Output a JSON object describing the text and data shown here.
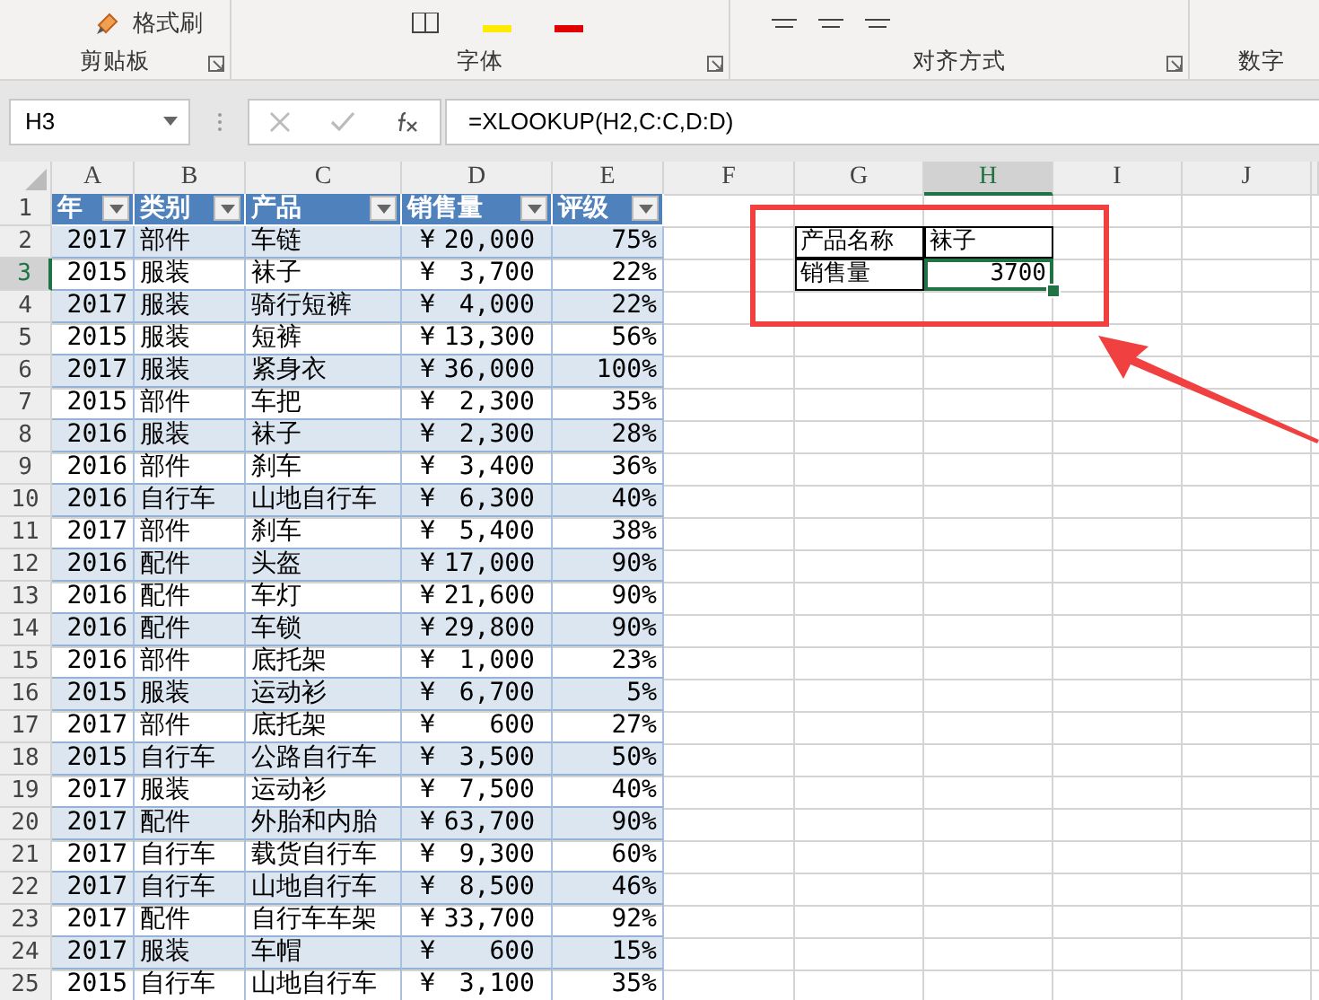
{
  "ribbon": {
    "format_painter": "格式刷",
    "groups": [
      {
        "label": "剪贴板"
      },
      {
        "label": "字体"
      },
      {
        "label": "对齐方式"
      },
      {
        "label": "数字"
      }
    ]
  },
  "formula_bar": {
    "name_box": "H3",
    "formula": "=XLOOKUP(H2,C:C,D:D)"
  },
  "column_headers": [
    {
      "label": "A",
      "selected": false
    },
    {
      "label": "B",
      "selected": false
    },
    {
      "label": "C",
      "selected": false
    },
    {
      "label": "D",
      "selected": false
    },
    {
      "label": "E",
      "selected": false
    },
    {
      "label": "F",
      "selected": false
    },
    {
      "label": "G",
      "selected": false
    },
    {
      "label": "H",
      "selected": true
    },
    {
      "label": "I",
      "selected": false
    },
    {
      "label": "J",
      "selected": false
    }
  ],
  "row_headers": [
    {
      "label": "1",
      "selected": false
    },
    {
      "label": "2",
      "selected": false
    },
    {
      "label": "3",
      "selected": true
    },
    {
      "label": "4",
      "selected": false
    },
    {
      "label": "5",
      "selected": false
    },
    {
      "label": "6",
      "selected": false
    },
    {
      "label": "7",
      "selected": false
    },
    {
      "label": "8",
      "selected": false
    },
    {
      "label": "9",
      "selected": false
    },
    {
      "label": "10",
      "selected": false
    },
    {
      "label": "11",
      "selected": false
    },
    {
      "label": "12",
      "selected": false
    },
    {
      "label": "13",
      "selected": false
    },
    {
      "label": "14",
      "selected": false
    },
    {
      "label": "15",
      "selected": false
    },
    {
      "label": "16",
      "selected": false
    },
    {
      "label": "17",
      "selected": false
    },
    {
      "label": "18",
      "selected": false
    },
    {
      "label": "19",
      "selected": false
    },
    {
      "label": "20",
      "selected": false
    },
    {
      "label": "21",
      "selected": false
    },
    {
      "label": "22",
      "selected": false
    },
    {
      "label": "23",
      "selected": false
    },
    {
      "label": "24",
      "selected": false
    },
    {
      "label": "25",
      "selected": false
    }
  ],
  "table": {
    "headers": [
      "年",
      "类别",
      "产品",
      "销售量",
      "评级"
    ],
    "rows": [
      {
        "year": "2017",
        "category": "部件",
        "product": "车链",
        "currency": "¥",
        "sales": "20,000",
        "rating": "75%"
      },
      {
        "year": "2015",
        "category": "服装",
        "product": "袜子",
        "currency": "¥",
        "sales": "3,700",
        "rating": "22%"
      },
      {
        "year": "2017",
        "category": "服装",
        "product": "骑行短裤",
        "currency": "¥",
        "sales": "4,000",
        "rating": "22%"
      },
      {
        "year": "2015",
        "category": "服装",
        "product": "短裤",
        "currency": "¥",
        "sales": "13,300",
        "rating": "56%"
      },
      {
        "year": "2017",
        "category": "服装",
        "product": "紧身衣",
        "currency": "¥",
        "sales": "36,000",
        "rating": "100%"
      },
      {
        "year": "2015",
        "category": "部件",
        "product": "车把",
        "currency": "¥",
        "sales": "2,300",
        "rating": "35%"
      },
      {
        "year": "2016",
        "category": "服装",
        "product": "袜子",
        "currency": "¥",
        "sales": "2,300",
        "rating": "28%"
      },
      {
        "year": "2016",
        "category": "部件",
        "product": "刹车",
        "currency": "¥",
        "sales": "3,400",
        "rating": "36%"
      },
      {
        "year": "2016",
        "category": "自行车",
        "product": "山地自行车",
        "currency": "¥",
        "sales": "6,300",
        "rating": "40%"
      },
      {
        "year": "2017",
        "category": "部件",
        "product": "刹车",
        "currency": "¥",
        "sales": "5,400",
        "rating": "38%"
      },
      {
        "year": "2016",
        "category": "配件",
        "product": "头盔",
        "currency": "¥",
        "sales": "17,000",
        "rating": "90%"
      },
      {
        "year": "2016",
        "category": "配件",
        "product": "车灯",
        "currency": "¥",
        "sales": "21,600",
        "rating": "90%"
      },
      {
        "year": "2016",
        "category": "配件",
        "product": "车锁",
        "currency": "¥",
        "sales": "29,800",
        "rating": "90%"
      },
      {
        "year": "2016",
        "category": "部件",
        "product": "底托架",
        "currency": "¥",
        "sales": "1,000",
        "rating": "23%"
      },
      {
        "year": "2015",
        "category": "服装",
        "product": "运动衫",
        "currency": "¥",
        "sales": "6,700",
        "rating": "5%"
      },
      {
        "year": "2017",
        "category": "部件",
        "product": "底托架",
        "currency": "¥",
        "sales": "600",
        "rating": "27%"
      },
      {
        "year": "2015",
        "category": "自行车",
        "product": "公路自行车",
        "currency": "¥",
        "sales": "3,500",
        "rating": "50%"
      },
      {
        "year": "2017",
        "category": "服装",
        "product": "运动衫",
        "currency": "¥",
        "sales": "7,500",
        "rating": "40%"
      },
      {
        "year": "2017",
        "category": "配件",
        "product": "外胎和内胎",
        "currency": "¥",
        "sales": "63,700",
        "rating": "90%"
      },
      {
        "year": "2017",
        "category": "自行车",
        "product": "载货自行车",
        "currency": "¥",
        "sales": "9,300",
        "rating": "60%"
      },
      {
        "year": "2017",
        "category": "自行车",
        "product": "山地自行车",
        "currency": "¥",
        "sales": "8,500",
        "rating": "46%"
      },
      {
        "year": "2017",
        "category": "配件",
        "product": "自行车车架",
        "currency": "¥",
        "sales": "33,700",
        "rating": "92%"
      },
      {
        "year": "2017",
        "category": "服装",
        "product": "车帽",
        "currency": "¥",
        "sales": "600",
        "rating": "15%"
      },
      {
        "year": "2015",
        "category": "自行车",
        "product": "山地自行车",
        "currency": "¥",
        "sales": "3,100",
        "rating": "35%"
      }
    ]
  },
  "lookup": {
    "name_label": "产品名称",
    "name_value": "袜子",
    "result_label": "销售量",
    "result_value": "3700"
  }
}
